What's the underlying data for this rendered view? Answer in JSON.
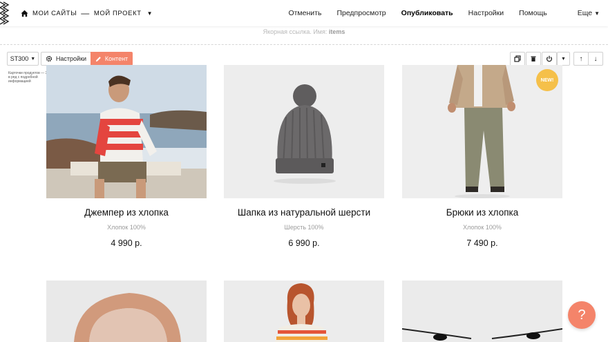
{
  "breadcrumbs": {
    "sites": "МОИ САЙТЫ",
    "separator": "—",
    "project": "МОЙ ПРОЕКТ"
  },
  "topnav": {
    "undo": "Отменить",
    "preview": "Предпросмотр",
    "publish": "Опубликовать",
    "settings": "Настройки",
    "help": "Помощь",
    "more": "Еще"
  },
  "anchor": {
    "label": "Якорная ссылка. Имя:",
    "name": "items"
  },
  "block_toolbar": {
    "block_code": "ST300",
    "settings_label": "Настройки",
    "content_label": "Контент",
    "block_description": "Карточки продуктов — 3 в ряд с подробной информацией"
  },
  "products": [
    {
      "title": "Джемпер из хлопка",
      "desc": "Хлопок 100%",
      "price": "4 990 р.",
      "image": "man-striped-sweater-seaside",
      "badge": ""
    },
    {
      "title": "Шапка из натуральной шерсти",
      "desc": "Шерсть 100%",
      "price": "6 990 р.",
      "image": "grey-knit-beanie",
      "badge": ""
    },
    {
      "title": "Брюки из хлопка",
      "desc": "Хлопок 100%",
      "price": "7 490 р.",
      "image": "man-khaki-trousers",
      "badge": "NEW!"
    }
  ],
  "accent_color": "#f4846a",
  "badge_color": "#f5c04a",
  "help_symbol": "?"
}
